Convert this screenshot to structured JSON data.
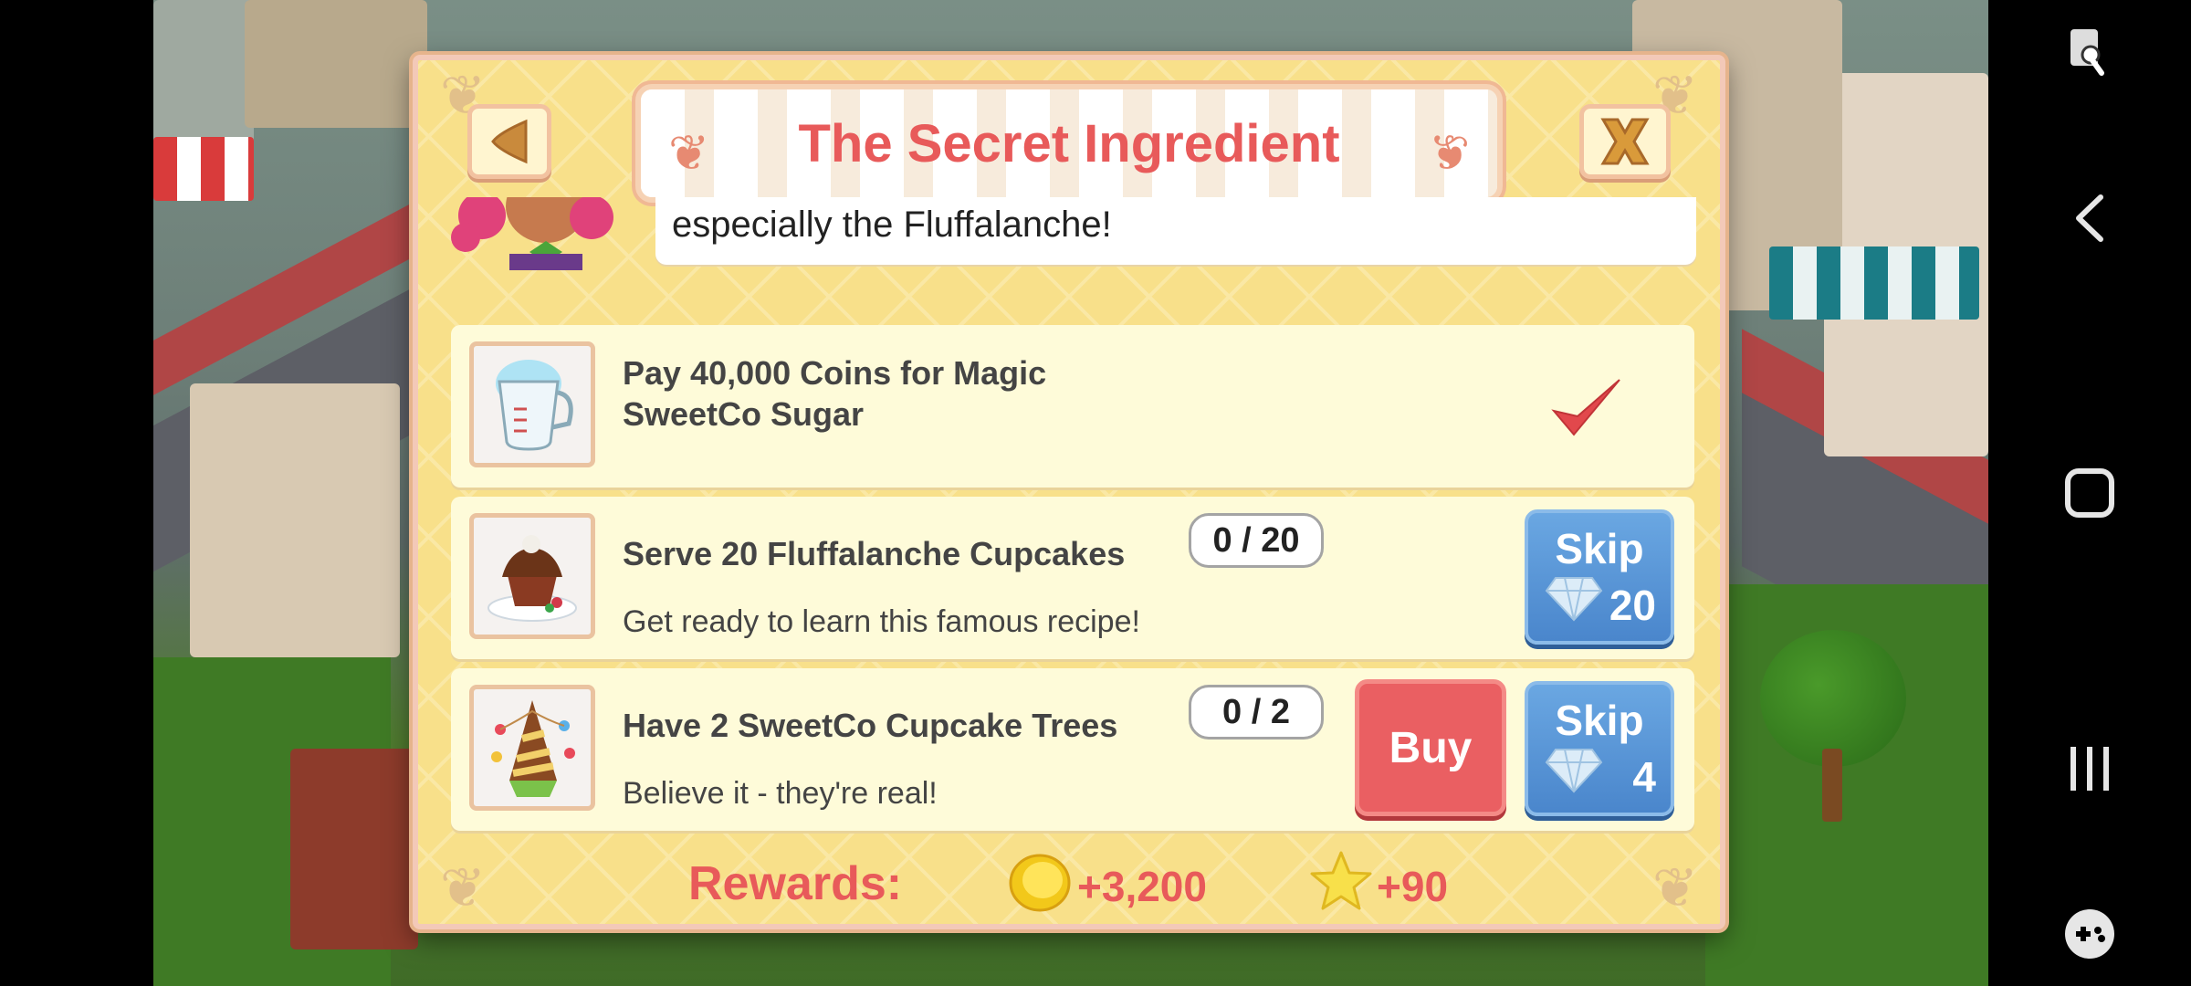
{
  "dialog": {
    "title": "The Secret Ingredient",
    "speech_text": "especially the Fluffalanche!"
  },
  "tasks": [
    {
      "title_line1": "Pay 40,000 Coins for Magic",
      "title_line2": "SweetCo Sugar",
      "icon": "measuring-cup-icon",
      "completed": true
    },
    {
      "title": "Serve 20 Fluffalanche Cupcakes",
      "subtitle": "Get ready to learn this famous recipe!",
      "progress": "0 / 20",
      "skip_label": "Skip",
      "skip_cost": "20",
      "icon": "cupcake-icon"
    },
    {
      "title": "Have 2 SweetCo Cupcake Trees",
      "subtitle": "Believe it - they're real!",
      "progress": "0 / 2",
      "buy_label": "Buy",
      "skip_label": "Skip",
      "skip_cost": "4",
      "icon": "cupcake-tree-icon"
    }
  ],
  "rewards": {
    "label": "Rewards:",
    "coins": "+3,200",
    "xp": "+90"
  },
  "colors": {
    "accent_red": "#e85a5a",
    "skip_blue": "#4a86cc",
    "panel_yellow": "#f8e08a"
  }
}
